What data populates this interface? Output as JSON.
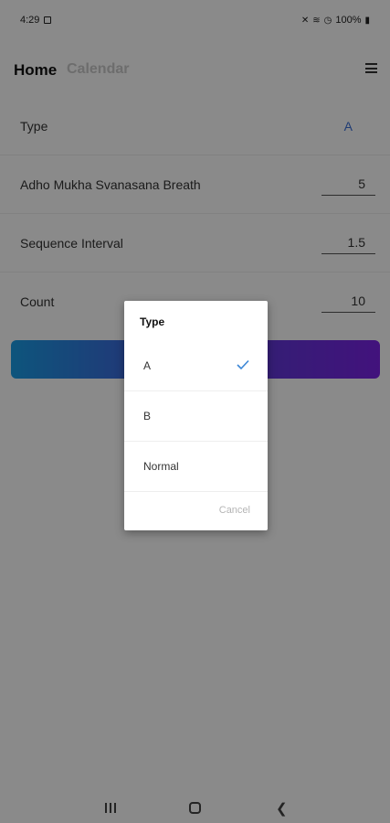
{
  "status_bar": {
    "time": "4:29",
    "battery": "100%"
  },
  "header": {
    "tabs": [
      "Home",
      "Calendar"
    ],
    "active_tab": "Home"
  },
  "settings": {
    "type": {
      "label": "Type",
      "value": "A"
    },
    "breath": {
      "label": "Adho Mukha Svanasana Breath",
      "value": "5"
    },
    "interval": {
      "label": "Sequence Interval",
      "value": "1.5"
    },
    "count": {
      "label": "Count",
      "value": "10"
    }
  },
  "dialog": {
    "title": "Type",
    "options": [
      "A",
      "B",
      "Normal"
    ],
    "selected": "A",
    "cancel_label": "Cancel"
  },
  "colors": {
    "accent": "#3b6fd6",
    "button_gradient_start": "#1a9de6",
    "button_gradient_end": "#7a22e6",
    "check": "#3b86d6"
  }
}
